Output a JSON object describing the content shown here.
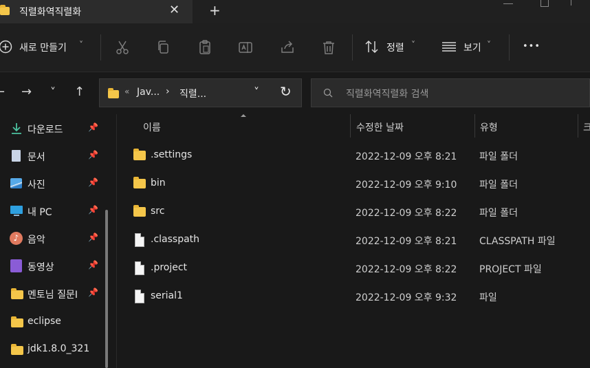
{
  "tab": {
    "title": "직렬화역직렬화",
    "close": "✕",
    "new_tab": "+"
  },
  "toolbar": {
    "new_label": "새로 만들기",
    "new_arrow": "˅",
    "sort_label": "정렬",
    "sort_arrow": "˅",
    "view_label": "보기",
    "view_arrow": "˅",
    "more": "•••"
  },
  "nav": {
    "back": "←",
    "forward": "→",
    "recent": "˅",
    "up": "↑",
    "refresh": "↻"
  },
  "address": {
    "overflow": "«",
    "crumbs": [
      "Jav...",
      "직렬..."
    ],
    "separator": "›",
    "dropdown": "˅"
  },
  "search": {
    "placeholder": "직렬화역직렬화 검색"
  },
  "sidebar": {
    "items": [
      {
        "label": "다운로드",
        "icon": "download-icon",
        "pinned": true
      },
      {
        "label": "문서",
        "icon": "document-icon",
        "pinned": true
      },
      {
        "label": "사진",
        "icon": "picture-icon",
        "pinned": true
      },
      {
        "label": "내 PC",
        "icon": "pc-icon",
        "pinned": true
      },
      {
        "label": "음악",
        "icon": "music-icon",
        "pinned": true
      },
      {
        "label": "동영상",
        "icon": "video-icon",
        "pinned": true
      },
      {
        "label": "멘토님 질문I",
        "icon": "folder-icon",
        "pinned": true
      },
      {
        "label": "eclipse",
        "icon": "folder-icon",
        "pinned": false
      },
      {
        "label": "jdk1.8.0_321",
        "icon": "folder-icon",
        "pinned": false
      }
    ],
    "pin_glyph": "📌"
  },
  "columns": {
    "name": "이름",
    "date": "수정한 날짜",
    "type": "유형",
    "extra": "크"
  },
  "files": [
    {
      "name": ".settings",
      "date": "2022-12-09 오후 8:21",
      "type": "파일 폴더",
      "kind": "folder"
    },
    {
      "name": "bin",
      "date": "2022-12-09 오후 9:10",
      "type": "파일 폴더",
      "kind": "folder"
    },
    {
      "name": "src",
      "date": "2022-12-09 오후 8:22",
      "type": "파일 폴더",
      "kind": "folder"
    },
    {
      "name": ".classpath",
      "date": "2022-12-09 오후 8:21",
      "type": "CLASSPATH 파일",
      "kind": "file"
    },
    {
      "name": ".project",
      "date": "2022-12-09 오후 8:22",
      "type": "PROJECT 파일",
      "kind": "file"
    },
    {
      "name": "serial1",
      "date": "2022-12-09 오후 9:32",
      "type": "파일",
      "kind": "file"
    }
  ],
  "colors": {
    "accent": "#4cc2ff",
    "folder": "#f4c64a",
    "background": "#191919"
  }
}
